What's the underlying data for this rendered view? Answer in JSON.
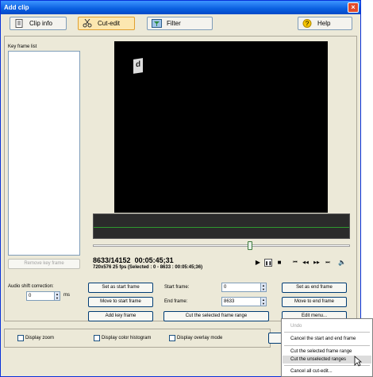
{
  "window": {
    "title": "Add clip",
    "close_label": "×"
  },
  "toolbar": {
    "clip_info": "Clip info",
    "cut_edit": "Cut-edit",
    "filter": "Filter",
    "help": "Help",
    "help_icon_glyph": "?"
  },
  "keyframes": {
    "heading": "Key frame list",
    "remove_label": "Remove key frame"
  },
  "video": {
    "logo_glyph": "d",
    "frame_readout": "8633/14152",
    "time_readout": "00:05:45;31",
    "info_line": "720x576 25 fps  (Selected : 0 - 8633 : 00:05:45;36)",
    "slider_position": 0.61
  },
  "transport": {
    "play": "▶",
    "pause": "❚❚",
    "stop": "■",
    "first": "⏮",
    "rewind": "◀◀",
    "forward": "▶▶",
    "last": "⏭",
    "volume": "🔈"
  },
  "audio_shift": {
    "label": "Audio shift correction:",
    "value": "0",
    "unit": "ms"
  },
  "frames": {
    "set_start_label": "Set as start frame",
    "move_start_label": "Move to start frame",
    "add_key_label": "Add key frame",
    "start_label": "Start frame:",
    "start_value": "0",
    "end_label": "End frame:",
    "end_value": "8633",
    "cut_range_label": "Cut the selected frame range",
    "set_end_label": "Set as end frame",
    "move_end_label": "Move to end frame",
    "edit_menu_label": "Edit menu..."
  },
  "options": {
    "zoom": "Display zoom",
    "histogram": "Display color histogram",
    "overlay": "Display overlay mode"
  },
  "menu": {
    "undo": "Undo",
    "cancel_start_end": "Cancel the start and end frame",
    "cut_selected": "Cut the selected frame range",
    "cut_unselected": "Cut the unselected ranges",
    "cancel_all": "Cancel all cut-edit..."
  },
  "colors": {
    "accent": "#0a5fe0",
    "video_bg": "#000000",
    "waveform_line": "#2f9a2f"
  }
}
